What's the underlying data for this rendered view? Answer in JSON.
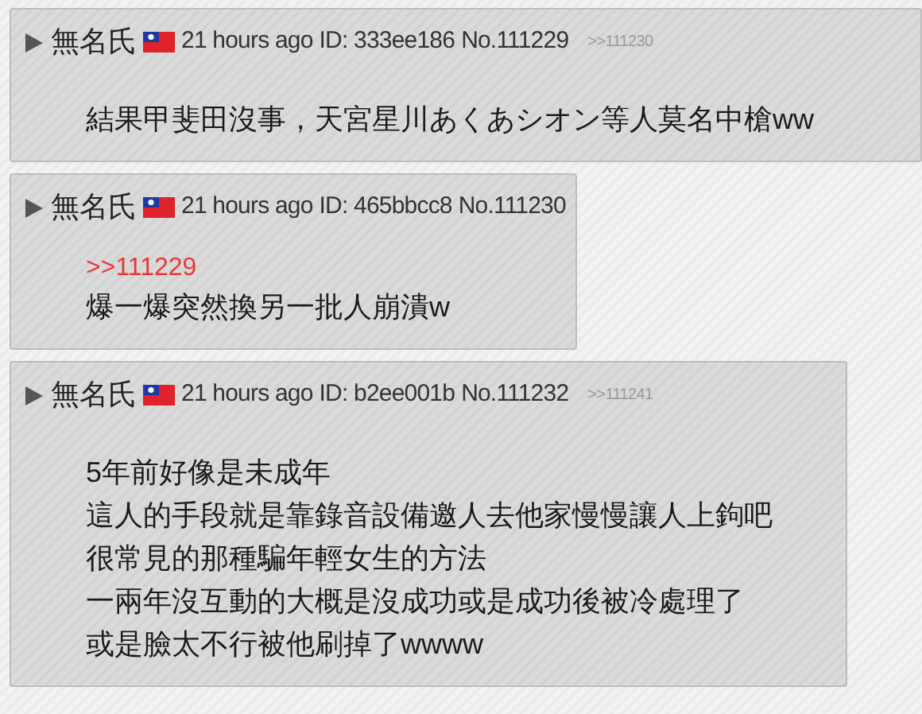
{
  "posts": [
    {
      "name": "無名氏",
      "time": "21 hours ago",
      "id": "ID: 333ee186",
      "no": "No.111229",
      "backlinks": [
        ">>111230"
      ],
      "lines": [
        "結果甲斐田沒事，天宮星川あくあシオン等人莫名中槍ww"
      ]
    },
    {
      "name": "無名氏",
      "time": "21 hours ago",
      "id": "ID: 465bbcc8",
      "no": "No.111230",
      "quote": ">>111229",
      "lines": [
        "爆一爆突然換另一批人崩潰w"
      ]
    },
    {
      "name": "無名氏",
      "time": "21 hours ago",
      "id": "ID: b2ee001b",
      "no": "No.111232",
      "backlinks": [
        ">>111241"
      ],
      "lines": [
        "5年前好像是未成年",
        "這人的手段就是靠錄音設備邀人去他家慢慢讓人上鉤吧",
        "很常見的那種騙年輕女生的方法",
        "一兩年沒互動的大概是沒成功或是成功後被冷處理了",
        "或是臉太不行被他刷掉了wwww"
      ]
    }
  ]
}
